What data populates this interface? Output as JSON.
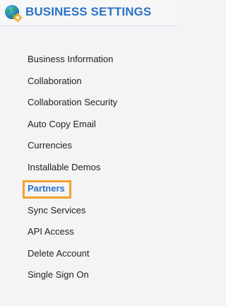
{
  "header": {
    "title": "BUSINESS SETTINGS",
    "logo_icon": "globe-gear-icon"
  },
  "menu": {
    "items": [
      {
        "label": "Business Information"
      },
      {
        "label": "Collaboration"
      },
      {
        "label": "Collaboration Security"
      },
      {
        "label": "Auto Copy Email"
      },
      {
        "label": "Currencies"
      },
      {
        "label": "Installable Demos"
      },
      {
        "label": "Partners",
        "active": true
      },
      {
        "label": "Sync Services"
      },
      {
        "label": "API Access"
      },
      {
        "label": "Delete Account"
      },
      {
        "label": "Single Sign On"
      }
    ]
  },
  "colors": {
    "accent": "#2b73c6",
    "highlight": "#f4a12a",
    "background": "#f3f4f6"
  }
}
